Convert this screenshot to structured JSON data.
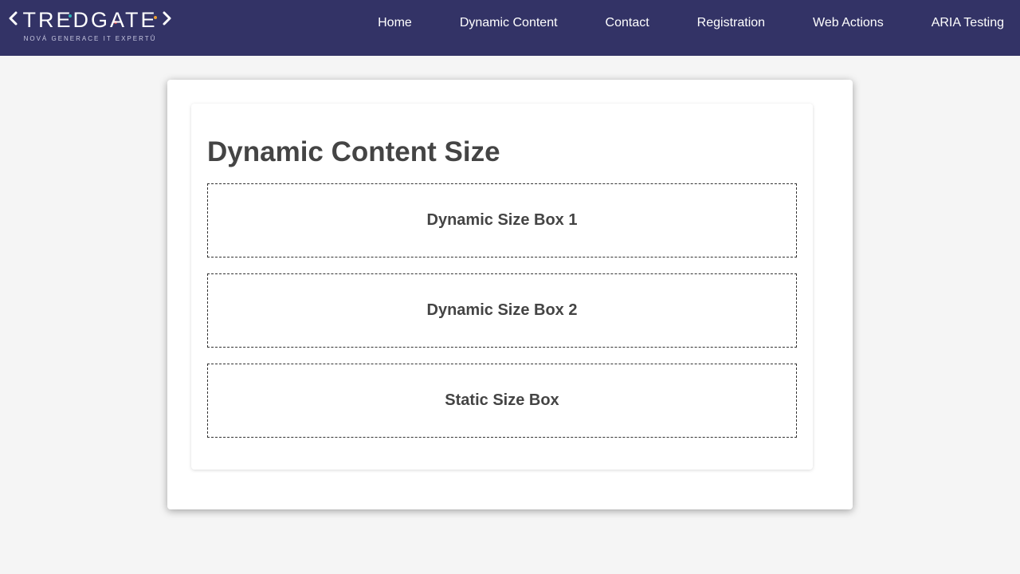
{
  "brand": {
    "name": "TREDGATE",
    "tagline": "NOVÁ GENERACE IT EXPERTŮ"
  },
  "nav": {
    "items": [
      {
        "label": "Home"
      },
      {
        "label": "Dynamic Content"
      },
      {
        "label": "Contact"
      },
      {
        "label": "Registration"
      },
      {
        "label": "Web Actions"
      },
      {
        "label": "ARIA Testing"
      }
    ]
  },
  "main": {
    "title": "Dynamic Content Size",
    "boxes": [
      {
        "label": "Dynamic Size Box 1"
      },
      {
        "label": "Dynamic Size Box 2"
      },
      {
        "label": "Static Size Box"
      }
    ]
  },
  "colors": {
    "navbar": "#333366",
    "background": "#f5f5f5",
    "text": "#444444",
    "logo_dot_teal": "#2bb5b5",
    "logo_dot_red": "#e05050",
    "logo_dot_orange": "#f0a030"
  }
}
